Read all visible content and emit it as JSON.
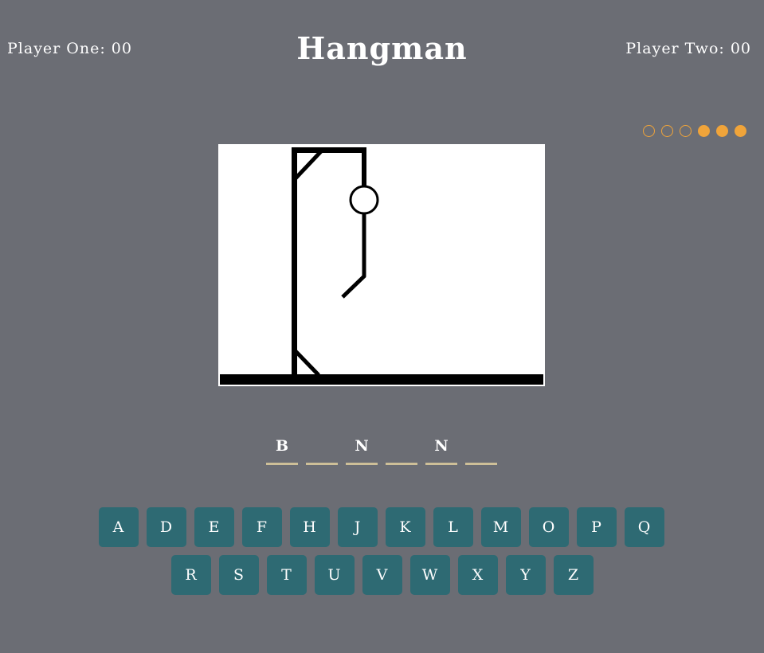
{
  "header": {
    "title": "Hangman",
    "player_one": "Player One: 00",
    "player_two": "Player Two: 00"
  },
  "lives": {
    "total": 6,
    "remaining": 3,
    "states": [
      "empty",
      "empty",
      "empty",
      "filled",
      "filled",
      "filled"
    ],
    "color": "#f0a43a"
  },
  "hangman": {
    "parts_drawn": [
      "gallows",
      "head",
      "body",
      "left-leg"
    ]
  },
  "word": {
    "slots": [
      "B",
      "",
      "N",
      "",
      "N",
      ""
    ]
  },
  "keyboard": {
    "row1": [
      "A",
      "D",
      "E",
      "F",
      "H",
      "J",
      "K",
      "L",
      "M",
      "O",
      "P",
      "Q"
    ],
    "row2": [
      "R",
      "S",
      "T",
      "U",
      "V",
      "W",
      "X",
      "Y",
      "Z"
    ],
    "key_color": "#2e6a73"
  },
  "colors": {
    "background": "#6b6d74",
    "underline": "#cdbf98"
  }
}
